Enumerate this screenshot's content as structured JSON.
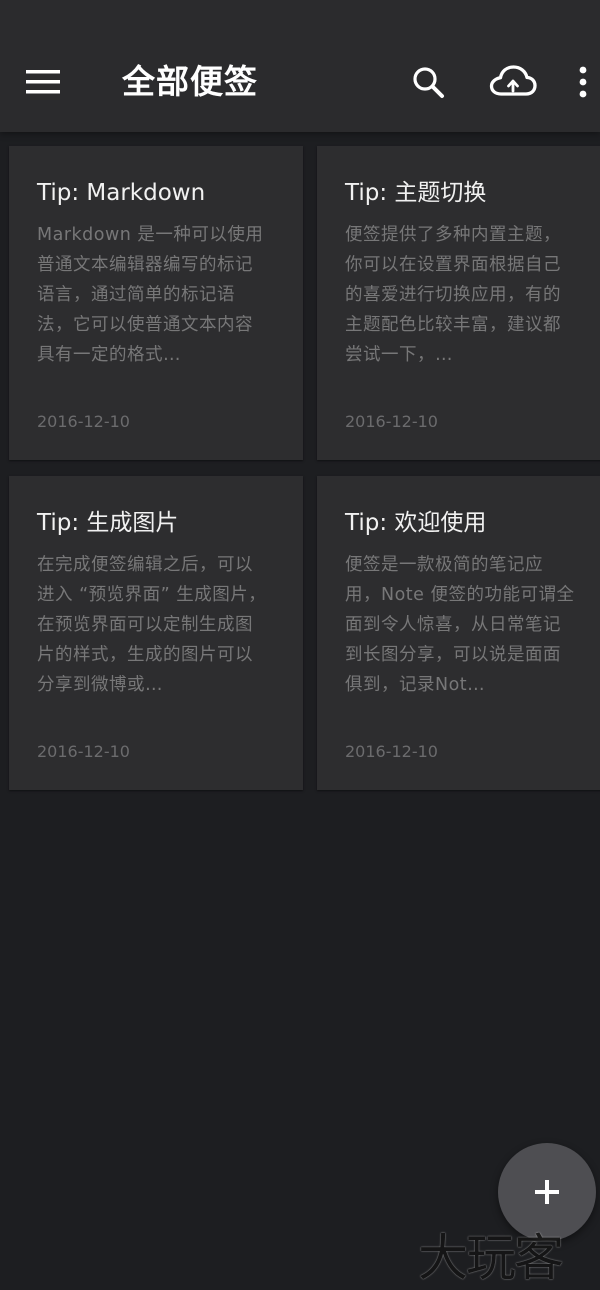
{
  "app_bar": {
    "title": "全部便签",
    "menu_icon": "menu-icon",
    "search_icon": "search-icon",
    "cloud_icon": "cloud-sync-icon",
    "more_icon": "more-vert-icon"
  },
  "notes": [
    {
      "title": "Tip: Markdown",
      "preview": "Markdown 是一种可以使用普通文本编辑器编写的标记语言，通过简单的标记语法，它可以使普通文本内容具有一定的格式…",
      "date": "2016-12-10"
    },
    {
      "title": "Tip: 主题切换",
      "preview": "便签提供了多种内置主题，你可以在设置界面根据自己的喜爱进行切换应用，有的主题配色比较丰富，建议都尝试一下，…",
      "date": "2016-12-10"
    },
    {
      "title": "Tip: 生成图片",
      "preview": "在完成便签编辑之后，可以进入 “预览界面” 生成图片，在预览界面可以定制生成图片的样式，生成的图片可以分享到微博或…",
      "date": "2016-12-10"
    },
    {
      "title": "Tip: 欢迎使用",
      "preview": "便签是一款极简的笔记应用，Note 便签的功能可谓全面到令人惊喜，从日常笔记到长图分享，可以说是面面俱到，记录Not…",
      "date": "2016-12-10"
    }
  ],
  "fab": {
    "icon": "add-icon"
  },
  "watermark": {
    "text": "大玩客"
  },
  "colors": {
    "app_bar": "#2b2b2d",
    "background": "#1d1e21",
    "card": "#2d2d2f",
    "fab": "#4e4e52"
  }
}
